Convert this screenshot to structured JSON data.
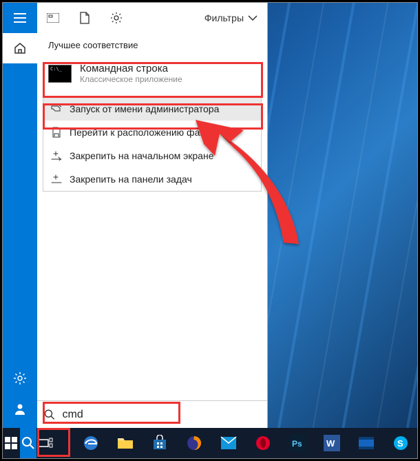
{
  "filters_label": "Фильтры",
  "section_label": "Лучшее соответствие",
  "best_match": {
    "title": "Командная строка",
    "subtitle": "Классическое приложение"
  },
  "context_menu": {
    "run_admin": "Запуск от имени администратора",
    "open_location": "Перейти к расположению файла",
    "pin_start": "Закрепить на начальном экране",
    "pin_taskbar": "Закрепить на панели задач"
  },
  "search_value": "cmd",
  "taskbar": {
    "pinned": [
      "edge",
      "explorer",
      "store",
      "firefox",
      "outlook",
      "opera",
      "photoshop",
      "word",
      "video",
      "skype"
    ]
  }
}
